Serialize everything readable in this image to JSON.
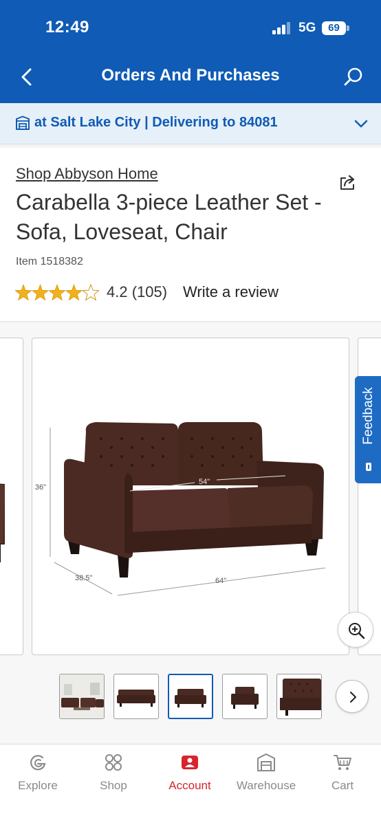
{
  "status_bar": {
    "time": "12:49",
    "network": "5G",
    "battery": "69"
  },
  "header": {
    "title": "Orders And Purchases"
  },
  "location": {
    "prefix": "at",
    "store": "Salt Lake City",
    "separator": "|",
    "delivery_label": "Delivering to",
    "zip": "84081"
  },
  "product": {
    "brand_link": "Shop Abbyson Home",
    "name": "Carabella 3-piece Leather Set - Sofa, Loveseat, Chair",
    "item_number": "Item 1518382",
    "rating_value": 4.2,
    "rating_text": "4.2 (105)",
    "write_review": "Write a review"
  },
  "gallery": {
    "dimensions": {
      "height": "36\"",
      "depth": "38.5\"",
      "width": "64\"",
      "seat": "54\""
    },
    "feedback_label": "Feedback",
    "active_thumbnail": 2,
    "thumbnail_count": 5
  },
  "tabs": [
    {
      "label": "Explore",
      "icon": "explore-icon"
    },
    {
      "label": "Shop",
      "icon": "shop-grid-icon"
    },
    {
      "label": "Account",
      "icon": "account-icon",
      "active": true
    },
    {
      "label": "Warehouse",
      "icon": "warehouse-icon"
    },
    {
      "label": "Cart",
      "icon": "cart-icon"
    }
  ],
  "colors": {
    "brand_blue": "#0f5bb5",
    "active_red": "#d8242c",
    "star_gold": "#f2b11b",
    "sofa_brown": "#4a2a22"
  }
}
